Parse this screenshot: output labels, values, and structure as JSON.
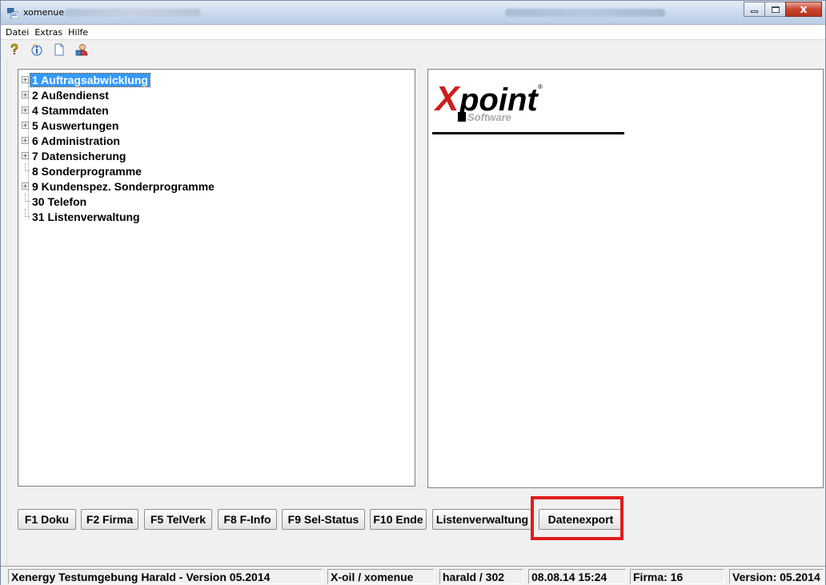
{
  "window": {
    "title": "xomenue",
    "controls": {
      "minimize_icon": "minimize-icon",
      "maximize_icon": "maximize-icon",
      "close_icon": "close-icon",
      "close_glyph": "x"
    }
  },
  "menu": {
    "items": [
      {
        "label": "Datei"
      },
      {
        "label": "Extras"
      },
      {
        "label": "Hilfe"
      }
    ]
  },
  "toolbar": {
    "icons": [
      "help-icon",
      "info-icon",
      "document-icon",
      "user-icon"
    ]
  },
  "tree": {
    "items": [
      {
        "label": "1  Auftragsabwicklung",
        "expandable": true,
        "selected": true
      },
      {
        "label": "2  Außendienst",
        "expandable": true
      },
      {
        "label": "4  Stammdaten",
        "expandable": true
      },
      {
        "label": "5  Auswertungen",
        "expandable": true
      },
      {
        "label": "6  Administration",
        "expandable": true
      },
      {
        "label": "7  Datensicherung",
        "expandable": true
      },
      {
        "label": "8  Sonderprogramme",
        "expandable": false
      },
      {
        "label": "9  Kundenspez. Sonderprogramme",
        "expandable": true
      },
      {
        "label": "30  Telefon",
        "expandable": false
      },
      {
        "label": "31  Listenverwaltung",
        "expandable": false
      }
    ],
    "expander_glyph": "+"
  },
  "logo": {
    "brand": "Xpoint",
    "sub": "Software",
    "registered": "®",
    "colors": {
      "x": "#cc1f1f",
      "text": "#000000"
    }
  },
  "buttons": [
    {
      "label": "F1 Doku"
    },
    {
      "label": "F2 Firma"
    },
    {
      "label": "F5 TelVerk"
    },
    {
      "label": "F8 F-Info"
    },
    {
      "label": "F9 Sel-Status"
    },
    {
      "label": "F10 Ende"
    },
    {
      "label": "Listenverwaltung"
    },
    {
      "label": "Datenexport",
      "highlighted": true
    }
  ],
  "highlight_color": "#e11c1c",
  "status": {
    "environment": "Xenergy Testumgebung Harald - Version 05.2014",
    "app": "X-oil / xomenue",
    "user": "harald / 302",
    "datetime": "08.08.14 15:24",
    "firma": "Firma:  16",
    "version": "Version: 05.2014"
  }
}
